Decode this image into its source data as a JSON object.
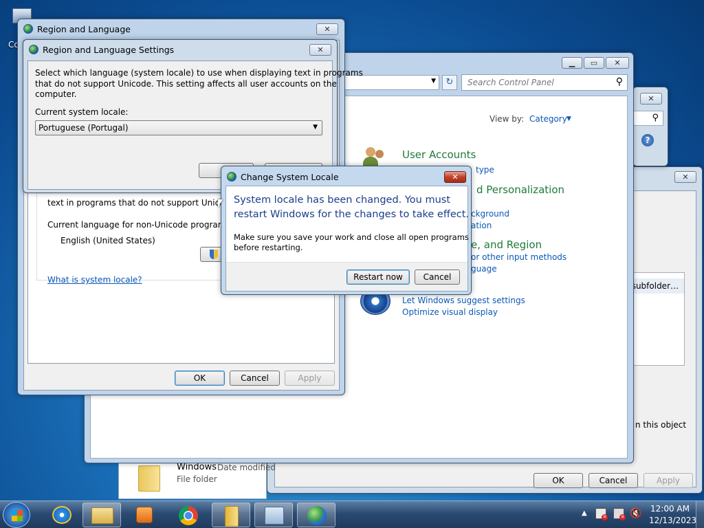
{
  "desktop": {
    "icon_label": "Co"
  },
  "control_panel": {
    "search_placeholder": "Search Control Panel",
    "view_by_label": "View by:",
    "view_by_value": "Category",
    "user_accounts": "User Accounts",
    "ua_sub": "type",
    "appearance": "d Personalization",
    "app_sub1": "ckground",
    "app_sub2": "ation",
    "clock": "e, and Region",
    "clock_sub1": "or other input methods",
    "clock_sub2": "guage",
    "ease_sub1": "Let Windows suggest settings",
    "ease_sub2": "Optimize visual display"
  },
  "bg_properties": {
    "subfolder_text": ", subfolder…",
    "object_text": "n this object",
    "ok": "OK",
    "cancel": "Cancel",
    "apply": "Apply"
  },
  "explorer_strip": {
    "name": "Windows",
    "date_modified": "Date modified",
    "type": "File folder"
  },
  "region_language": {
    "title": "Region and Language",
    "unicode_text": "text in programs that do not support Unicode.",
    "current_lang_label": "Current language for non-Unicode programs:",
    "current_lang_value": "English (United States)",
    "what_is_link": "What is system locale?",
    "ok": "OK",
    "cancel": "Cancel",
    "apply": "Apply"
  },
  "settings_dialog": {
    "title": "Region and Language Settings",
    "desc_1": "Select which language (system locale) to use when displaying text in programs",
    "desc_2": "that do not support Unicode. This setting affects all user accounts on the",
    "desc_3": "computer.",
    "locale_label": "Current system locale:",
    "locale_value": "Portuguese (Portugal)"
  },
  "change_locale": {
    "title": "Change System Locale",
    "main_1": "System locale has been changed. You must",
    "main_2": "restart Windows for the changes to take effect.",
    "sub_1": "Make sure you save your work and close all open programs",
    "sub_2": "before restarting.",
    "restart": "Restart now",
    "cancel": "Cancel"
  },
  "tray": {
    "time": "12:00 AM",
    "date": "12/13/2023"
  },
  "colors": {
    "accent": "#1e5fa0",
    "green_heading": "#1e7a3a",
    "link": "#0a58b6"
  }
}
